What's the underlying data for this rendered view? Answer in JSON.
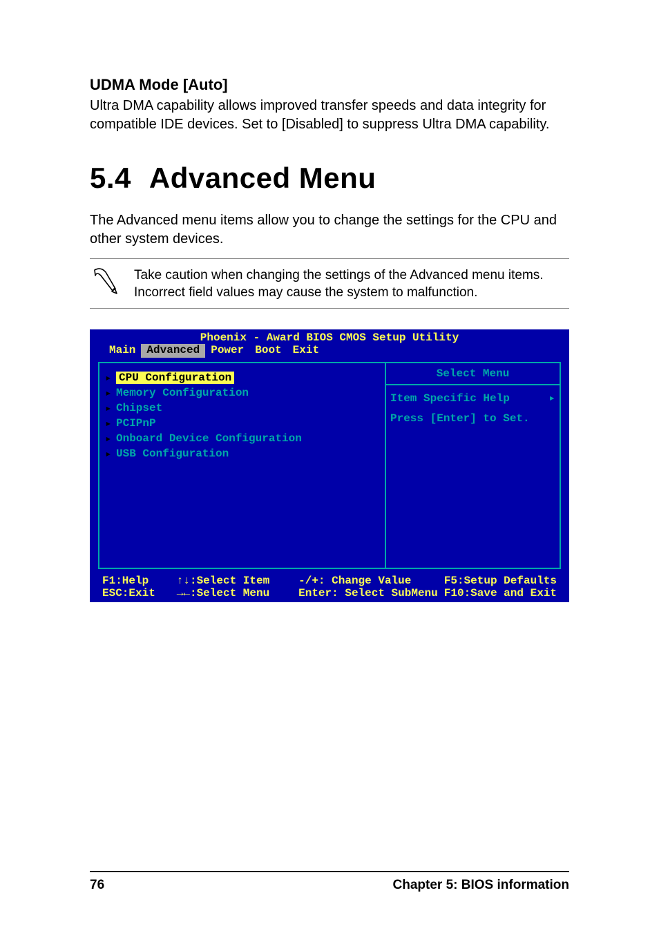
{
  "section": {
    "title": "UDMA Mode [Auto]",
    "body": "Ultra DMA capability allows improved transfer speeds and data integrity for compatible IDE devices. Set to [Disabled] to suppress Ultra DMA capability."
  },
  "chapter": {
    "number": "5.4",
    "title": "Advanced Menu",
    "intro": "The Advanced menu items allow you to change the settings for the CPU and other system devices.",
    "note": "Take caution when changing the settings of the Advanced menu items. Incorrect field values may cause the system to malfunction."
  },
  "bios": {
    "title": "Phoenix - Award BIOS CMOS Setup Utility",
    "tabs": [
      "Main",
      "Advanced",
      "Power",
      "Boot",
      "Exit"
    ],
    "active_tab_index": 1,
    "left_items": [
      "CPU Configuration",
      "Memory Configuration",
      "Chipset",
      "PCIPnP",
      "Onboard Device Configuration",
      "USB Configuration"
    ],
    "right": {
      "title": "Select Menu",
      "help_label": "Item Specific Help",
      "help_text": "Press [Enter] to Set."
    },
    "footer": {
      "row1": {
        "c1": "F1:Help",
        "c2": "↑↓:Select Item",
        "c3": "-/+: Change Value",
        "c4": "F5:Setup Defaults"
      },
      "row2": {
        "c1": "ESC:Exit",
        "c2": "→←:Select Menu",
        "c3": "Enter: Select SubMenu",
        "c4": "F10:Save and Exit"
      }
    }
  },
  "page_footer": {
    "page_number": "76",
    "chapter_label": "Chapter 5:  BIOS information"
  }
}
